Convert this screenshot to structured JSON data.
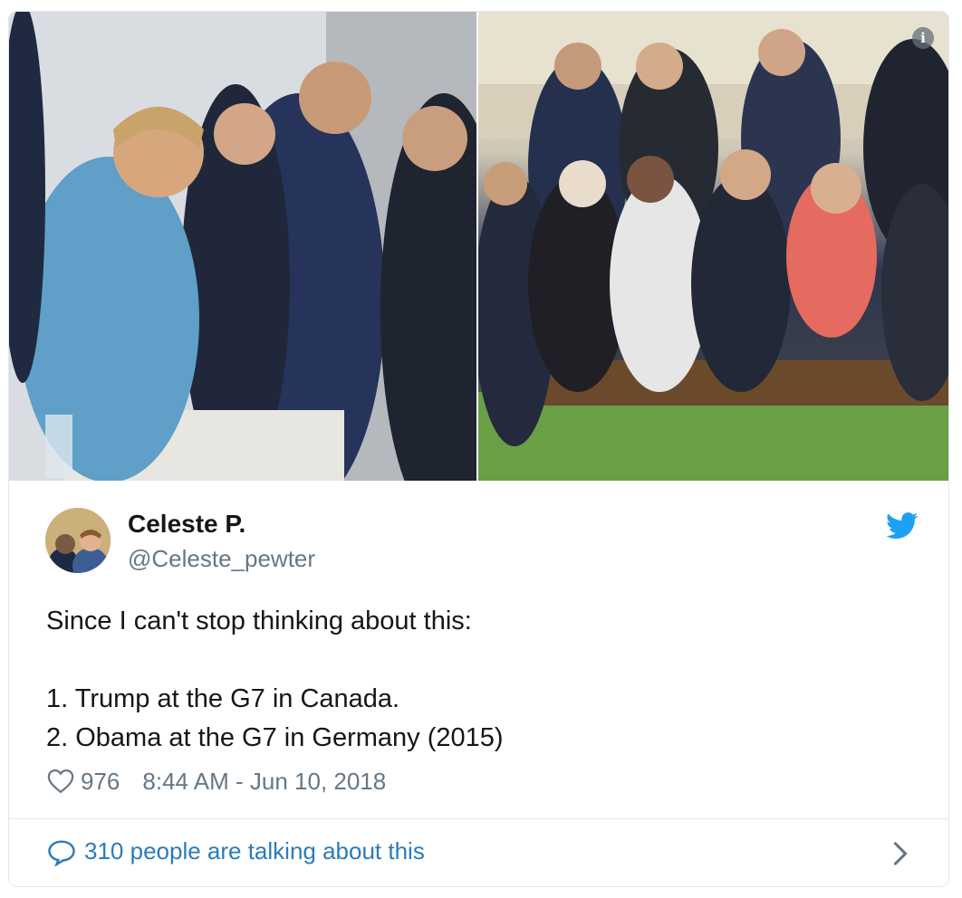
{
  "tweet": {
    "display_name": "Celeste P.",
    "handle": "@Celeste_pewter",
    "text_lines": [
      "Since I can't stop thinking about this:",
      "",
      "1. Trump at the G7 in Canada.",
      "2. Obama at the G7 in Germany (2015)"
    ],
    "like_count": "976",
    "timestamp": "8:44 AM - Jun 10, 2018"
  },
  "footer": {
    "talking_label": "310 people are talking about this"
  },
  "icons": {
    "info": "info-icon",
    "twitter": "twitter-bird-icon",
    "heart": "heart-icon",
    "reply": "speech-bubble-icon",
    "chevron": "chevron-right-icon"
  },
  "colors": {
    "text_primary": "#14171a",
    "text_secondary": "#657786",
    "link": "#2b7bb9",
    "twitter_blue": "#1da1f2",
    "border": "#e1e8ed"
  }
}
